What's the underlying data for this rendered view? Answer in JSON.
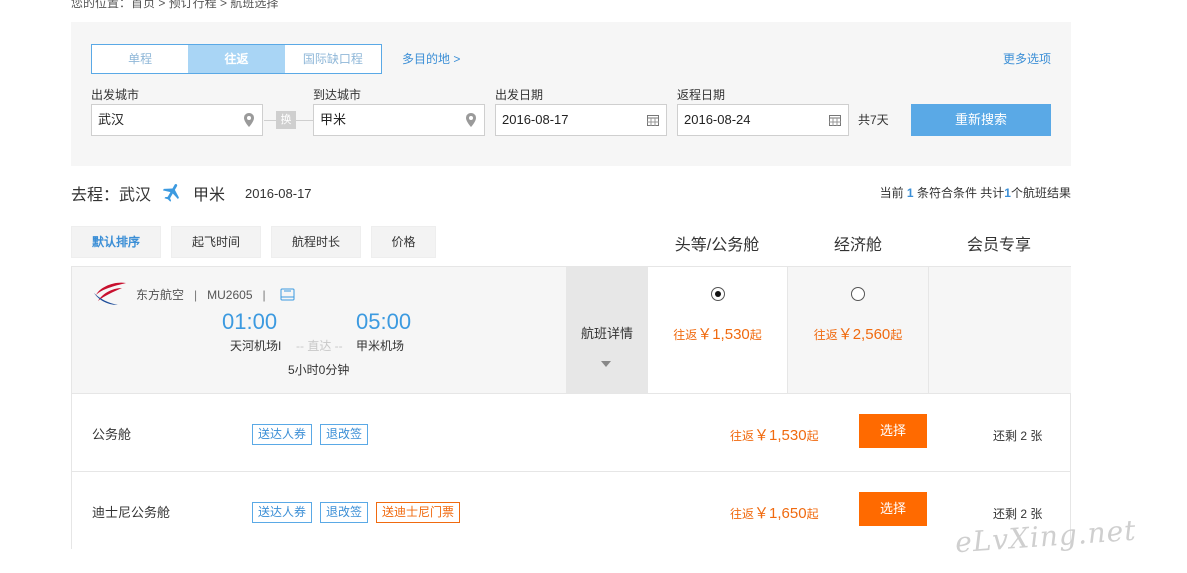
{
  "breadcrumb": "您的位置：首页 > 预订行程 > 航班选择",
  "search": {
    "trip_tabs": [
      "单程",
      "往返",
      "国际缺口程"
    ],
    "active_tab": "往返",
    "multi_dest": "多目的地 >",
    "more_options": "更多选项",
    "from_label": "出发城市",
    "from_value": "武汉",
    "to_label": "到达城市",
    "to_value": "甲米",
    "swap_label": "换",
    "depart_label": "出发日期",
    "depart_value": "2016-08-17",
    "return_label": "返程日期",
    "return_value": "2016-08-24",
    "days": "共7天",
    "research_button": "重新搜索"
  },
  "route": {
    "prefix": "去程：武汉",
    "dest": "甲米",
    "date": "2016-08-17",
    "plane_icon": "plane-icon"
  },
  "result": {
    "text1": "当前",
    "count1": "1",
    "text2": "条符合条件 共计",
    "count2": "1",
    "text3": "个航班结果"
  },
  "sort": [
    "默认排序",
    "起飞时间",
    "航程时长",
    "价格"
  ],
  "class_heads": [
    "头等/公务舱",
    "经济舱",
    "会员专享"
  ],
  "flight": {
    "airline": "东方航空",
    "flight_no": "MU2605",
    "dep_time": "01:00",
    "arr_time": "05:00",
    "dep_airport": "天河机场I",
    "arr_airport": "甲米机场",
    "direct": "-- 直达 --",
    "duration": "5小时0分钟",
    "detail_label": "航班详情",
    "fares": [
      {
        "prefix": "往返",
        "amount": "￥1,530",
        "suffix": "起",
        "selected": true
      },
      {
        "prefix": "往返",
        "amount": "￥2,560",
        "suffix": "起",
        "selected": false
      }
    ]
  },
  "cabins": [
    {
      "name": "公务舱",
      "tags": [
        "送达人券",
        "退改签"
      ],
      "price_prefix": "往返",
      "price": "￥1,530",
      "price_suffix": "起",
      "button": "选择",
      "remain": "还剩 2 张"
    },
    {
      "name": "迪士尼公务舱",
      "tags": [
        "送达人券",
        "退改签",
        "送迪士尼门票"
      ],
      "price_prefix": "往返",
      "price": "￥1,650",
      "price_suffix": "起",
      "button": "选择",
      "remain": "还剩 2 张"
    }
  ],
  "watermark": "eLvXing.net",
  "colors": {
    "accent": "#5aa9e6",
    "price": "#f06a0f",
    "select_button": "#ff6a00"
  }
}
